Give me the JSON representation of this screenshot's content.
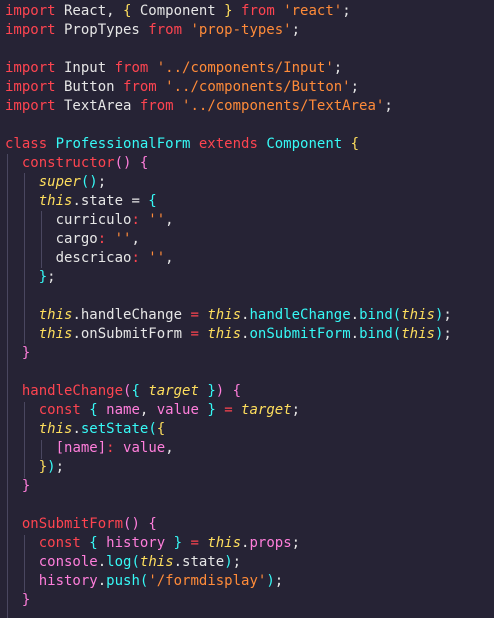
{
  "code_lines": [
    [
      [
        "kw",
        "import"
      ],
      [
        "tx",
        " React, "
      ],
      [
        "br1",
        "{"
      ],
      [
        "tx",
        " Component "
      ],
      [
        "br1",
        "}"
      ],
      [
        "kw",
        " from "
      ],
      [
        "str",
        "'react'"
      ],
      [
        "tx",
        ";"
      ]
    ],
    [
      [
        "kw",
        "import"
      ],
      [
        "tx",
        " PropTypes "
      ],
      [
        "kw",
        "from "
      ],
      [
        "str",
        "'prop-types'"
      ],
      [
        "tx",
        ";"
      ]
    ],
    [],
    [
      [
        "kw",
        "import"
      ],
      [
        "tx",
        " Input "
      ],
      [
        "kw",
        "from "
      ],
      [
        "str",
        "'../components/Input'"
      ],
      [
        "tx",
        ";"
      ]
    ],
    [
      [
        "kw",
        "import"
      ],
      [
        "tx",
        " Button "
      ],
      [
        "kw",
        "from "
      ],
      [
        "str",
        "'../components/Button'"
      ],
      [
        "tx",
        ";"
      ]
    ],
    [
      [
        "kw",
        "import"
      ],
      [
        "tx",
        " TextArea "
      ],
      [
        "kw",
        "from "
      ],
      [
        "str",
        "'../components/TextArea'"
      ],
      [
        "tx",
        ";"
      ]
    ],
    [],
    [
      [
        "kw",
        "class"
      ],
      [
        "cls",
        " ProfessionalForm"
      ],
      [
        "kw",
        " extends"
      ],
      [
        "cls",
        " Component"
      ],
      [
        "tx",
        " "
      ],
      [
        "br1",
        "{"
      ]
    ],
    [
      [
        "tx",
        "  "
      ],
      [
        "fn",
        "constructor"
      ],
      [
        "br2",
        "()"
      ],
      [
        "tx",
        " "
      ],
      [
        "br2",
        "{"
      ]
    ],
    [
      [
        "tx",
        "    "
      ],
      [
        "sup",
        "super"
      ],
      [
        "br3",
        "()"
      ],
      [
        "tx",
        ";"
      ]
    ],
    [
      [
        "tx",
        "    "
      ],
      [
        "th",
        "this"
      ],
      [
        "tx",
        ".state = "
      ],
      [
        "br3",
        "{"
      ]
    ],
    [
      [
        "tx",
        "      curriculo"
      ],
      [
        "op",
        ":"
      ],
      [
        "str",
        " ''"
      ],
      [
        "tx",
        ","
      ]
    ],
    [
      [
        "tx",
        "      cargo"
      ],
      [
        "op",
        ":"
      ],
      [
        "str",
        " ''"
      ],
      [
        "tx",
        ","
      ]
    ],
    [
      [
        "tx",
        "      descricao"
      ],
      [
        "op",
        ":"
      ],
      [
        "str",
        " ''"
      ],
      [
        "tx",
        ","
      ]
    ],
    [
      [
        "tx",
        "    "
      ],
      [
        "br3",
        "}"
      ],
      [
        "tx",
        ";"
      ]
    ],
    [],
    [
      [
        "tx",
        "    "
      ],
      [
        "th",
        "this"
      ],
      [
        "tx",
        ".handleChange "
      ],
      [
        "op",
        "="
      ],
      [
        "th",
        " this"
      ],
      [
        "tx",
        "."
      ],
      [
        "meth",
        "handleChange"
      ],
      [
        "tx",
        "."
      ],
      [
        "meth",
        "bind"
      ],
      [
        "br3",
        "("
      ],
      [
        "th",
        "this"
      ],
      [
        "br3",
        ")"
      ],
      [
        "tx",
        ";"
      ]
    ],
    [
      [
        "tx",
        "    "
      ],
      [
        "th",
        "this"
      ],
      [
        "tx",
        ".onSubmitForm "
      ],
      [
        "op",
        "="
      ],
      [
        "th",
        " this"
      ],
      [
        "tx",
        "."
      ],
      [
        "meth",
        "onSubmitForm"
      ],
      [
        "tx",
        "."
      ],
      [
        "meth",
        "bind"
      ],
      [
        "br3",
        "("
      ],
      [
        "th",
        "this"
      ],
      [
        "br3",
        ")"
      ],
      [
        "tx",
        ";"
      ]
    ],
    [
      [
        "tx",
        "  "
      ],
      [
        "br2",
        "}"
      ]
    ],
    [],
    [
      [
        "tx",
        "  "
      ],
      [
        "fn",
        "handleChange"
      ],
      [
        "br2",
        "("
      ],
      [
        "br3",
        "{"
      ],
      [
        "arg",
        " target "
      ],
      [
        "br3",
        "}"
      ],
      [
        "br2",
        ")"
      ],
      [
        "tx",
        " "
      ],
      [
        "br2",
        "{"
      ]
    ],
    [
      [
        "tx",
        "    "
      ],
      [
        "kw",
        "const "
      ],
      [
        "br3",
        "{"
      ],
      [
        "prop",
        " name"
      ],
      [
        "tx",
        ", "
      ],
      [
        "prop",
        "value "
      ],
      [
        "br3",
        "}"
      ],
      [
        "op",
        " ="
      ],
      [
        "arg",
        " target"
      ],
      [
        "tx",
        ";"
      ]
    ],
    [
      [
        "tx",
        "    "
      ],
      [
        "th",
        "this"
      ],
      [
        "tx",
        "."
      ],
      [
        "meth",
        "setState"
      ],
      [
        "br3",
        "("
      ],
      [
        "br1",
        "{"
      ]
    ],
    [
      [
        "tx",
        "      "
      ],
      [
        "br2",
        "["
      ],
      [
        "prop",
        "name"
      ],
      [
        "br2",
        "]"
      ],
      [
        "op",
        ":"
      ],
      [
        "prop",
        " value"
      ],
      [
        "tx",
        ","
      ]
    ],
    [
      [
        "tx",
        "    "
      ],
      [
        "br1",
        "}"
      ],
      [
        "br3",
        ")"
      ],
      [
        "tx",
        ";"
      ]
    ],
    [
      [
        "tx",
        "  "
      ],
      [
        "br2",
        "}"
      ]
    ],
    [],
    [
      [
        "tx",
        "  "
      ],
      [
        "fn",
        "onSubmitForm"
      ],
      [
        "br2",
        "()"
      ],
      [
        "tx",
        " "
      ],
      [
        "br2",
        "{"
      ]
    ],
    [
      [
        "tx",
        "    "
      ],
      [
        "kw",
        "const "
      ],
      [
        "br3",
        "{"
      ],
      [
        "prop",
        " history "
      ],
      [
        "br3",
        "}"
      ],
      [
        "op",
        " ="
      ],
      [
        "th",
        " this"
      ],
      [
        "tx",
        "."
      ],
      [
        "prop",
        "props"
      ],
      [
        "tx",
        ";"
      ]
    ],
    [
      [
        "tx",
        "    "
      ],
      [
        "prop",
        "console"
      ],
      [
        "tx",
        "."
      ],
      [
        "meth",
        "log"
      ],
      [
        "br3",
        "("
      ],
      [
        "th",
        "this"
      ],
      [
        "tx",
        ".state"
      ],
      [
        "br3",
        ")"
      ],
      [
        "tx",
        ";"
      ]
    ],
    [
      [
        "tx",
        "    "
      ],
      [
        "prop",
        "history"
      ],
      [
        "tx",
        "."
      ],
      [
        "meth",
        "push"
      ],
      [
        "br3",
        "("
      ],
      [
        "str",
        "'/formdisplay'"
      ],
      [
        "br3",
        ")"
      ],
      [
        "tx",
        ";"
      ]
    ],
    [
      [
        "tx",
        "  "
      ],
      [
        "br2",
        "}"
      ]
    ]
  ]
}
